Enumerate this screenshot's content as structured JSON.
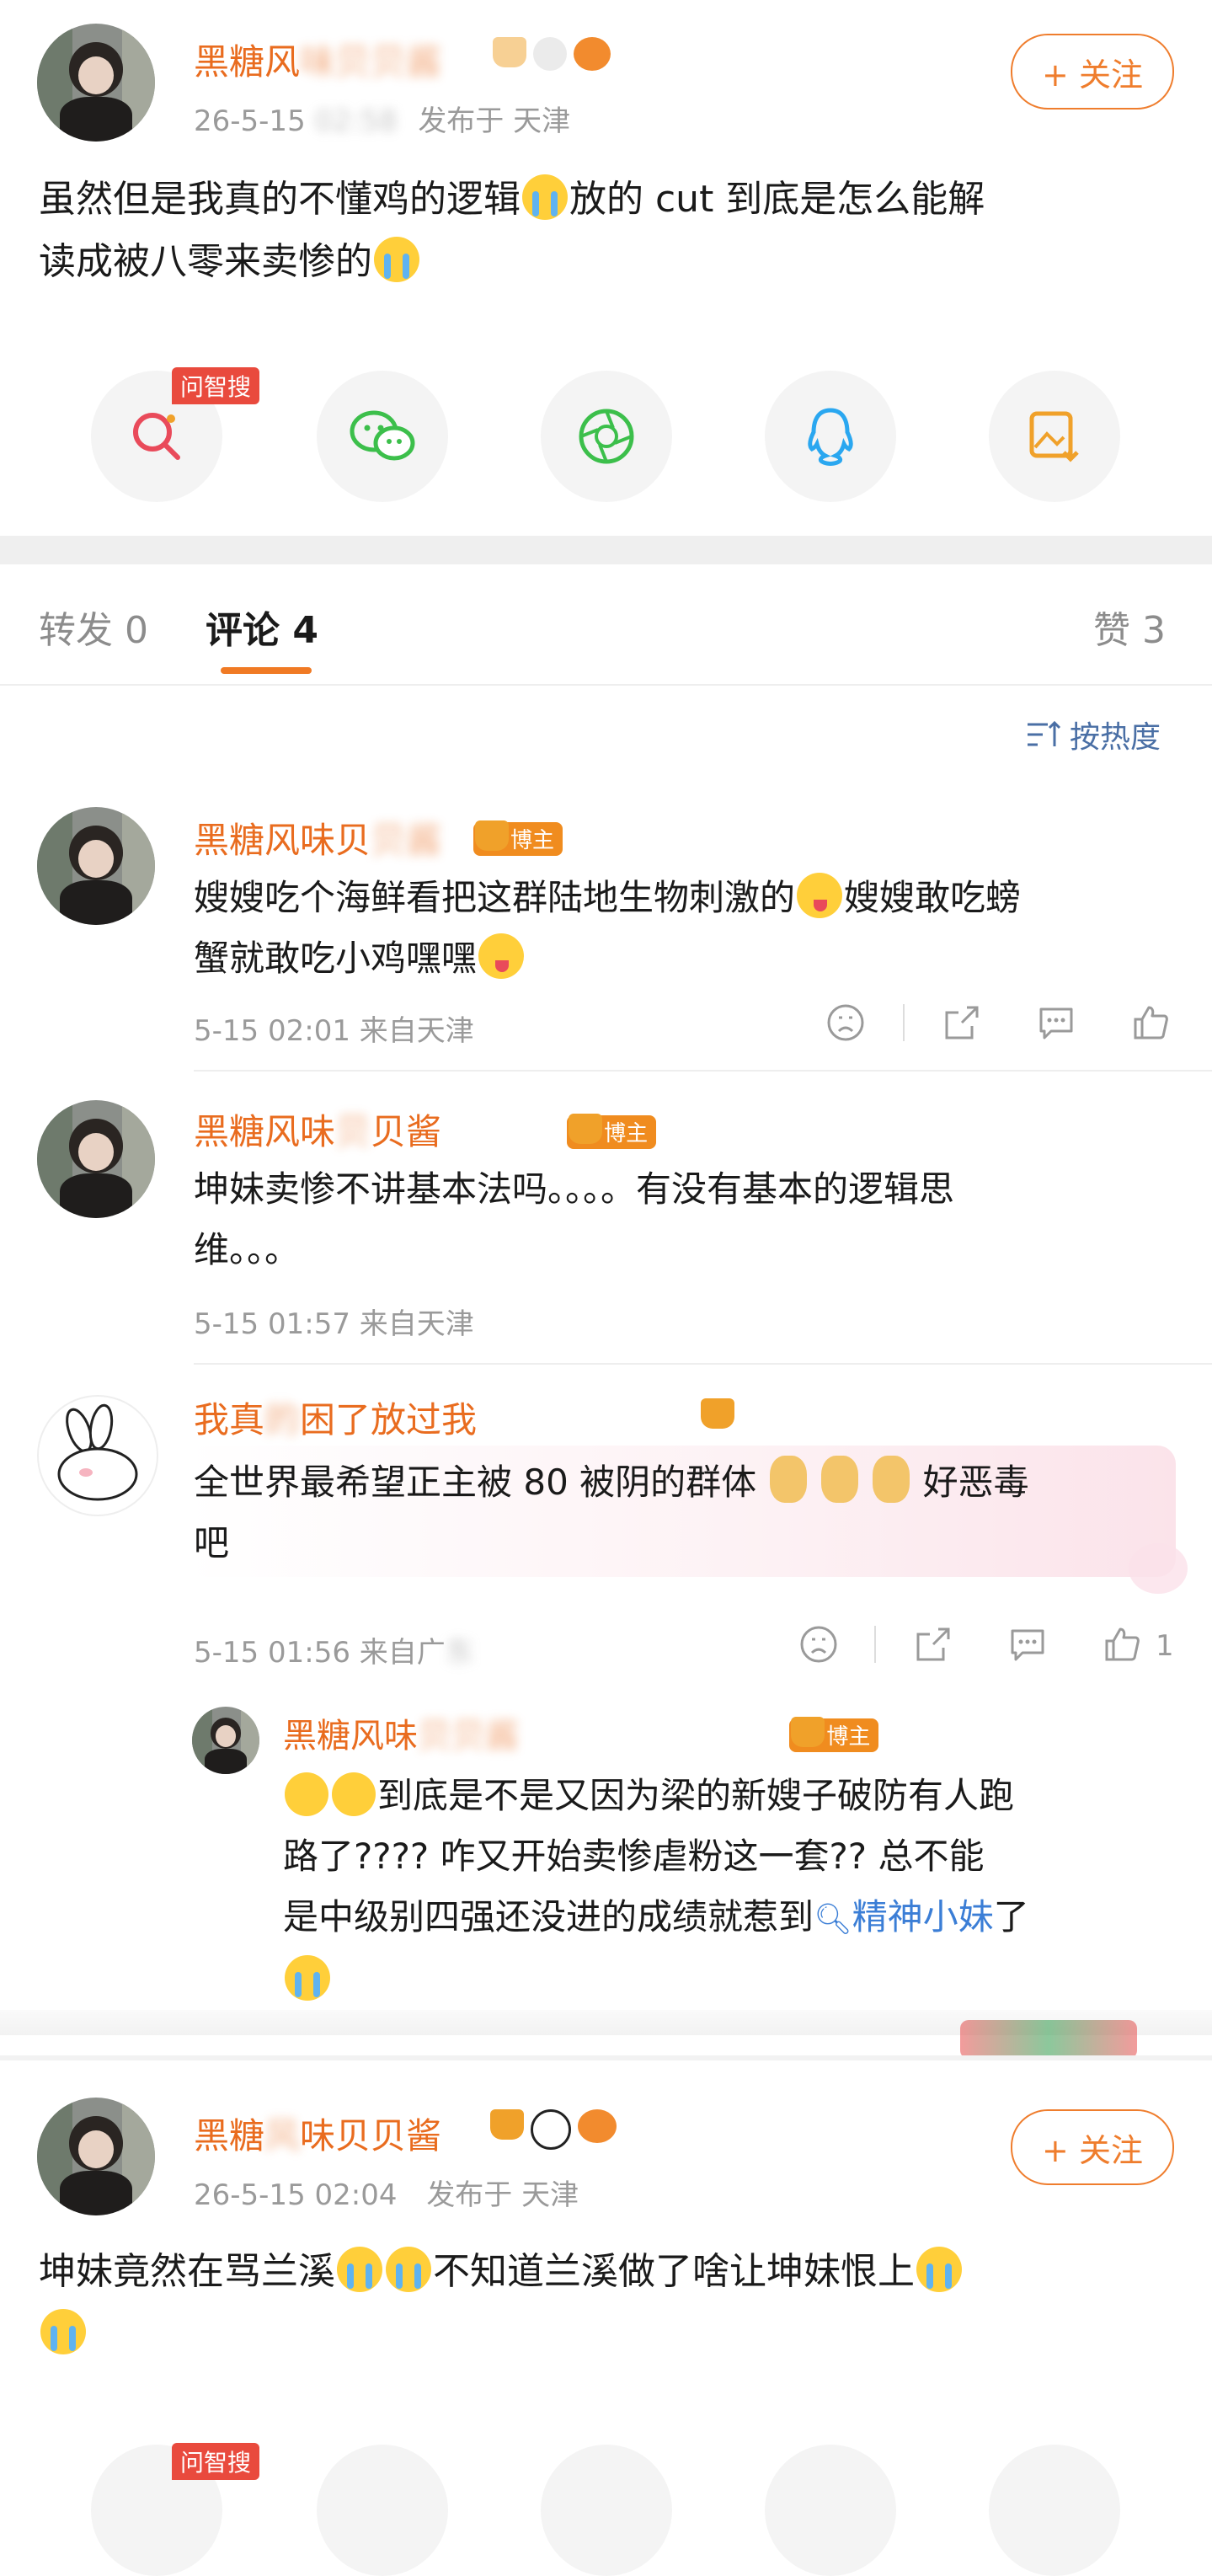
{
  "post_top": {
    "username_visible": "黑糖风",
    "username_blurred": "味贝贝酱",
    "time_visible": "26-5-15",
    "time_blurred": "02:58",
    "posted_from": "发布于 天津",
    "follow_label": "+ 关注",
    "text_line1": "虽然但是我真的不懂鸡的逻辑",
    "text_line1b": "放的 cut 到底是怎么能解",
    "text_line2": "读成被八零来卖惨的"
  },
  "share_bar": {
    "search_badge": "问智搜",
    "items": [
      "search-ai",
      "wechat",
      "moments",
      "qq",
      "save-image"
    ]
  },
  "tabs": {
    "repost": "转发 0",
    "comments": "评论 4",
    "likes": "赞 3"
  },
  "sort_label": "按热度",
  "comments": [
    {
      "username": "黑糖风味贝",
      "username_blurred": "贝酱",
      "badge": "博主",
      "text_a": "嫂嫂吃个海鲜看把这群陆地生物刺激的",
      "text_b": "嫂嫂敢吃螃",
      "text_c": "蟹就敢吃小鸡嘿嘿",
      "meta": "5-15 02:01 来自天津"
    },
    {
      "username": "黑糖风味",
      "username_blurred": "贝",
      "username_tail": "贝酱",
      "badge": "博主",
      "text_a": "坤妹卖惨不讲基本法吗。。。。有没有基本的逻辑思",
      "text_b": "维。。。",
      "meta": "5-15 01:57 来自天津"
    },
    {
      "username": "我真",
      "username_blurred": "的",
      "username_tail": "困了放过我",
      "text_a": "全世界最希望正主被 80 被阴的群体",
      "text_b": "好恶毒",
      "text_c": "吧",
      "meta_visible": "5-15 01:56 来自广",
      "meta_blurred": "东",
      "like_count": "1",
      "reply": {
        "username": "黑糖风味",
        "username_blurred": "贝贝酱",
        "badge": "博主",
        "text_a": "到底是不是又因为梁的新嫂子破防有人跑",
        "text_b": "路了???? 咋又开始卖惨虐粉这一套?? 总不能",
        "text_c": "是中级别四强还没进的成绩就惹到",
        "link": "精神小妹",
        "text_d": "了"
      }
    }
  ],
  "post_bottom": {
    "username_a": "黑糖",
    "username_blurred": "风",
    "username_b": "味贝贝酱",
    "time": "26-5-15 02:04",
    "posted_from": "发布于 天津",
    "follow_label": "+ 关注",
    "text_a": "坤妹竟然在骂兰溪",
    "text_b": "不知道兰溪做了啥让坤妹恨上",
    "search_badge": "问智搜"
  }
}
